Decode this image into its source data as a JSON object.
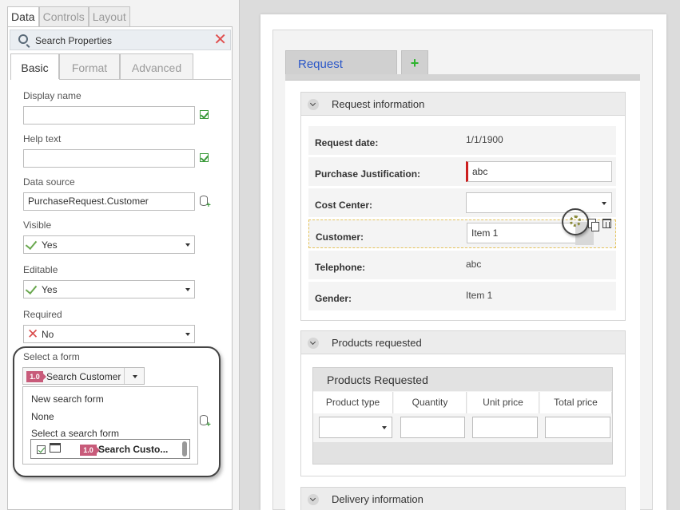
{
  "left_panel": {
    "top_tabs": [
      "Data",
      "Controls",
      "Layout"
    ],
    "search": {
      "placeholder": "Search Properties",
      "close_icon": "close-icon"
    },
    "sub_tabs": [
      "Basic",
      "Format",
      "Advanced"
    ],
    "fields": {
      "display_name": {
        "label": "Display name",
        "value": ""
      },
      "help_text": {
        "label": "Help text",
        "value": ""
      },
      "data_source": {
        "label": "Data source",
        "value": "PurchaseRequest.Customer"
      },
      "visible": {
        "label": "Visible",
        "value": "Yes"
      },
      "editable": {
        "label": "Editable",
        "value": "Yes"
      },
      "required": {
        "label": "Required",
        "value": "No"
      },
      "select_form": {
        "label": "Select a form",
        "version": "1.0",
        "value": "Search Customer"
      }
    },
    "dropdown": {
      "items": [
        "New search form",
        "None"
      ],
      "group_label": "Select a search form",
      "list_item": {
        "version": "1.0",
        "name": "Search Custo..."
      }
    }
  },
  "form": {
    "tabs": {
      "active": "Request",
      "add": "+"
    },
    "sections": {
      "request": {
        "title": "Request information",
        "rows": {
          "request_date": {
            "label": "Request date:",
            "value": "1/1/1900"
          },
          "purchase_justification": {
            "label": "Purchase Justification:",
            "value": "abc"
          },
          "cost_center": {
            "label": "Cost Center:",
            "value": ""
          },
          "customer": {
            "label": "Customer:",
            "value": "Item 1"
          },
          "telephone": {
            "label": "Telephone:",
            "value": "abc"
          },
          "gender": {
            "label": "Gender:",
            "value": "Item 1"
          }
        }
      },
      "products": {
        "title": "Products requested",
        "grid_title": "Products Requested",
        "columns": [
          "Product type",
          "Quantity",
          "Unit price",
          "Total price"
        ]
      },
      "delivery": {
        "title": "Delivery information"
      }
    }
  },
  "colors": {
    "tab_text": "#2b57c8",
    "required_bar": "#cc1f1f",
    "yes_check": "#6aa84f",
    "no_cross": "#d94a4a",
    "version_badge": "#c85b7a"
  }
}
